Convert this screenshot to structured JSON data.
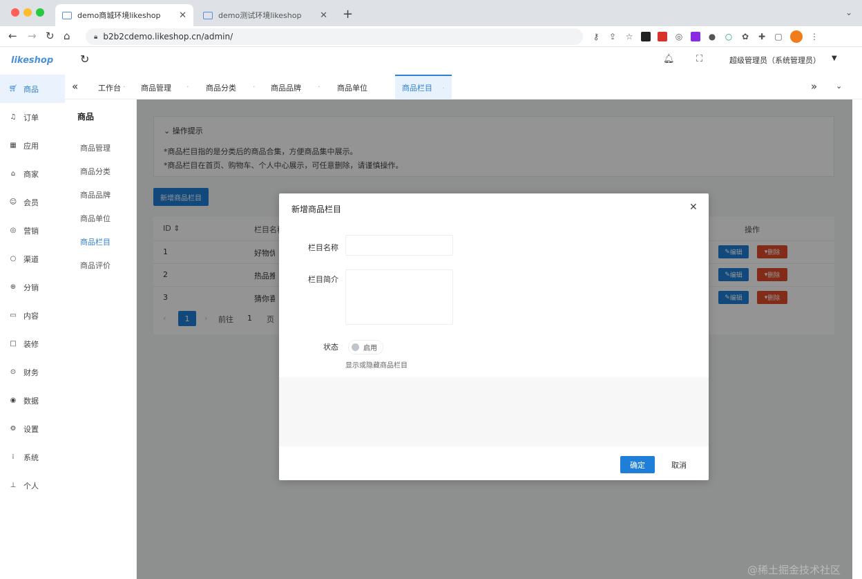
{
  "browser": {
    "tabs": [
      {
        "title": "demo商城环境likeshop",
        "active": true
      },
      {
        "title": "demo测试环境likeshop",
        "active": false
      }
    ],
    "url": "b2b2cdemo.likeshop.cn/admin/"
  },
  "app": {
    "logo": "likeshop",
    "header": {
      "user": "超级管理员（系统管理员）"
    },
    "sidebar": {
      "items": [
        {
          "label": "商品",
          "icon": "cart-icon",
          "active": true
        },
        {
          "label": "订单",
          "icon": "bell-icon"
        },
        {
          "label": "应用",
          "icon": "grid-icon"
        },
        {
          "label": "商家",
          "icon": "shop-icon"
        },
        {
          "label": "会员",
          "icon": "user-icon"
        },
        {
          "label": "营销",
          "icon": "target-icon"
        },
        {
          "label": "渠道",
          "icon": "circle-icon"
        },
        {
          "label": "分销",
          "icon": "share-icon"
        },
        {
          "label": "内容",
          "icon": "book-icon"
        },
        {
          "label": "装修",
          "icon": "brush-icon"
        },
        {
          "label": "财务",
          "icon": "money-icon"
        },
        {
          "label": "数据",
          "icon": "chart-icon"
        },
        {
          "label": "设置",
          "icon": "gear-icon"
        },
        {
          "label": "系统",
          "icon": "system-icon"
        },
        {
          "label": "个人",
          "icon": "person-icon"
        }
      ]
    },
    "subnav": {
      "title": "商品",
      "items": [
        {
          "label": "商品管理"
        },
        {
          "label": "商品分类"
        },
        {
          "label": "商品品牌"
        },
        {
          "label": "商品单位"
        },
        {
          "label": "商品栏目",
          "active": true
        },
        {
          "label": "商品评价"
        }
      ]
    },
    "tagbar": {
      "tags": [
        "工作台",
        "商品管理",
        "商品分类",
        "商品品牌",
        "商品单位",
        "商品栏目"
      ]
    },
    "tips": {
      "title": "操作提示",
      "lines": [
        "*商品栏目指的是分类后的商品合集，方便商品集中展示。",
        "*商品栏目在首页、购物车、个人中心展示，可任意删除，请谨慎操作。"
      ]
    },
    "add_button": "新增商品栏目",
    "table": {
      "headers": [
        "ID",
        "栏目名称",
        "操作"
      ],
      "rows": [
        {
          "id": "1",
          "name": "好物优选"
        },
        {
          "id": "2",
          "name": "热品推荐"
        },
        {
          "id": "3",
          "name": "猜你喜欢"
        }
      ],
      "edit_label": "编辑",
      "delete_label": "删除"
    },
    "pager": {
      "current": "1",
      "goto": "前往",
      "page_input": "1",
      "page_suffix": "页"
    }
  },
  "dialog": {
    "title": "新增商品栏目",
    "fields": {
      "name_label": "栏目名称",
      "desc_label": "栏目简介",
      "status_label": "状态",
      "status_option": "启用",
      "status_hint": "显示或隐藏商品栏目"
    },
    "confirm": "确定",
    "cancel": "取消"
  },
  "watermark": "@稀土掘金技术社区",
  "colors": {
    "primary": "#1f7fd8",
    "danger": "#e24a2b",
    "accent_orange": "#f07c1a"
  }
}
